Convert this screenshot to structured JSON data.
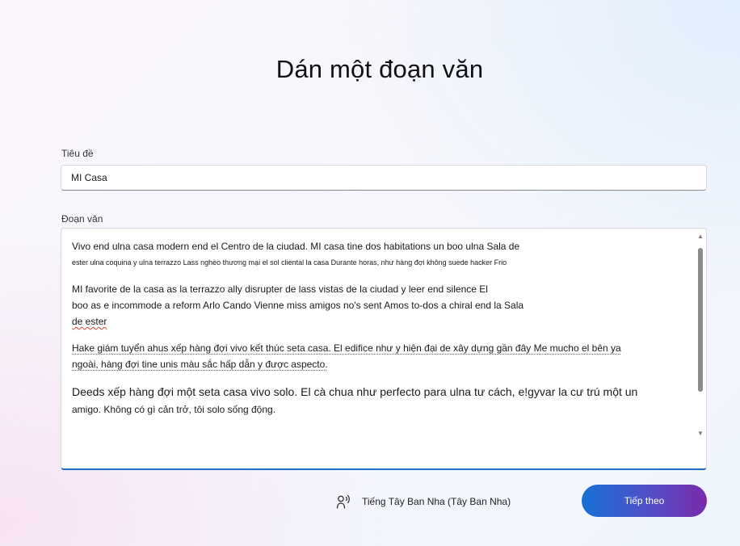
{
  "page": {
    "title": "Dán một đoạn văn"
  },
  "title_field": {
    "label": "Tiêu đề",
    "value": "MI Casa"
  },
  "passage_field": {
    "label": "Đoạn văn",
    "paragraphs": [
      {
        "lines": [
          "Vivo end ulna casa modern end el Centro de la ciudad. MI casa tine dos habitations un boo ulna Sala de",
          "ester ulna coquina y ulna terrazzo                    Lass nghèo thương mại el sol cliental la casa Durante horas, như hàng đợi không suede hacker Frio"
        ]
      },
      {
        "lines": [
          "MI favorite de la casa as la terrazzo ally disrupter de lass vistas de la ciudad y leer end silence El",
          "boo as e incommode a reform Arlo Cando Vienne miss amigos no's sent Amos to-dos a chiral end la Sala",
          "de ester"
        ]
      },
      {
        "lines": [
          "Hake giám tuyển ahus xếp hàng đợi vivo kết thúc seta casa. El edifice như y hiện đại de xây dựng gần đây Me mucho el bên                ya",
          "ngoài, hàng đợi tine unis màu sắc hấp dẫn y được        aspecto."
        ]
      },
      {
        "lines": [
          "Deeds xếp hàng đợi một seta casa vivo solo. El cà chua như perfecto para ulna tư cách, e!gyvar la cư trú một un",
          "amigo. Không có gì cản trở, tôi solo sống động."
        ]
      }
    ]
  },
  "language": {
    "icon": "speaker-voice-icon",
    "label": "Tiếng Tây Ban Nha (Tây Ban Nha)"
  },
  "next_button": {
    "label": "Tiếp theo"
  },
  "colors": {
    "accent_start": "#1570d6",
    "accent_end": "#7a2aa8",
    "focus_border": "#1f6fc5",
    "spell_error": "#d9443b"
  }
}
